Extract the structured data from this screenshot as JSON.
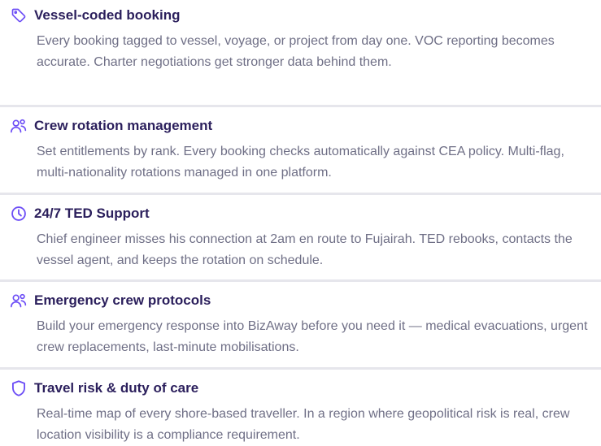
{
  "colors": {
    "accent": "#6c4df6",
    "title": "#2b1f5c",
    "body_text": "#6f6f86",
    "divider": "#e6e6ec"
  },
  "features": [
    {
      "icon": "tag-icon",
      "title": "Vessel-coded booking",
      "description": "Every booking tagged to vessel, voyage, or project from day one. VOC reporting becomes accurate. Charter negotiations get stronger data behind them."
    },
    {
      "icon": "users-icon",
      "title": "Crew rotation management",
      "description": "Set entitlements by rank. Every booking checks automatically against CEA policy. Multi-flag, multi-nationality rotations managed in one platform."
    },
    {
      "icon": "clock-icon",
      "title": "24/7 TED Support",
      "description": "Chief engineer misses his connection at 2am en route to Fujairah. TED rebooks, contacts the vessel agent, and keeps the rotation on schedule."
    },
    {
      "icon": "users-icon",
      "title": "Emergency crew protocols",
      "description": "Build your emergency response into BizAway before you need it — medical evacuations, urgent crew replacements, last-minute mobilisations."
    },
    {
      "icon": "shield-icon",
      "title": "Travel risk & duty of care",
      "description": "Real-time map of every shore-based traveller. In a region where geopolitical risk is real, crew location visibility is a compliance requirement."
    }
  ]
}
